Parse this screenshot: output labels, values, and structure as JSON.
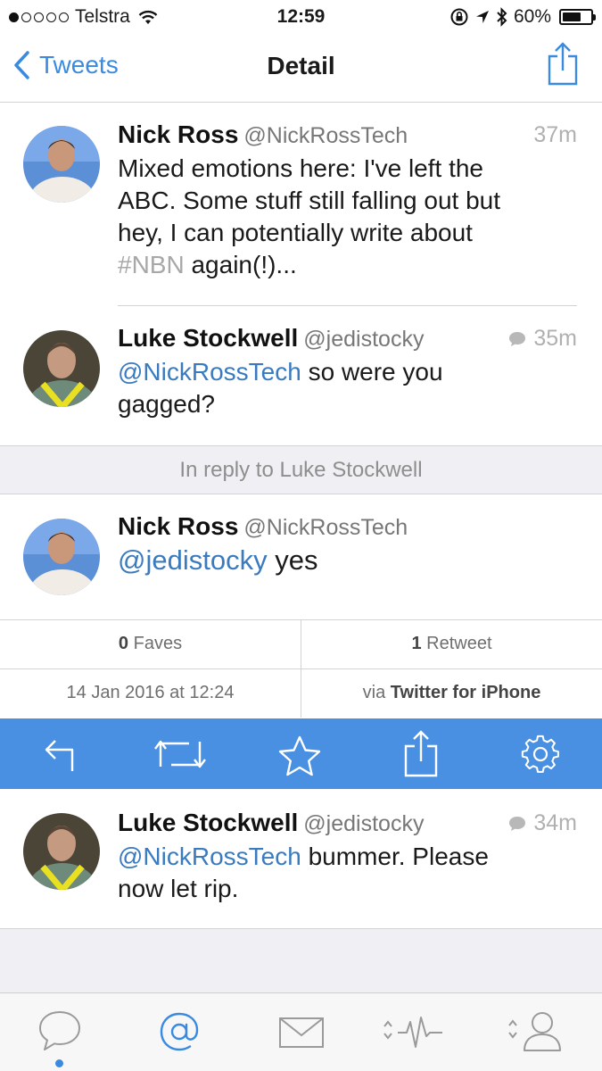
{
  "status_bar": {
    "carrier": "Telstra",
    "time": "12:59",
    "battery": "60%",
    "signal_bars": 1
  },
  "nav": {
    "back_label": "Tweets",
    "title": "Detail"
  },
  "tweets": [
    {
      "name": "Nick Ross",
      "handle": "@NickRossTech",
      "time": "37m",
      "body_lines": [
        "Mixed emotions here: I've left the",
        "ABC. Some stuff still falling out but",
        "hey, I can potentially write about"
      ],
      "hashtag": "#NBN",
      "body_tail": " again(!)..."
    },
    {
      "name": "Luke Stockwell",
      "handle": "@jedistocky",
      "time": "35m",
      "mention": "@NickRossTech",
      "body_rest": " so were you",
      "body_line2": "gagged?"
    },
    {
      "name": "Nick Ross",
      "handle": "@NickRossTech",
      "mention": "@jedistocky",
      "body_rest": " yes"
    },
    {
      "name": "Luke Stockwell",
      "handle": "@jedistocky",
      "time": "34m",
      "mention": "@NickRossTech",
      "body_rest": " bummer. Please",
      "body_line2": "now let rip."
    }
  ],
  "reply_bar": "In reply to Luke Stockwell",
  "stats": {
    "faves_count": "0",
    "faves_label": " Faves",
    "retweets_count": "1",
    "retweets_label": " Retweet",
    "date": "14 Jan 2016 at 12:24",
    "via_prefix": "via ",
    "via_app": "Twitter for iPhone"
  },
  "colors": {
    "accent": "#4a90e2",
    "link": "#3a7bbf",
    "background_gray": "#efeff4"
  },
  "icons": {
    "action_bar": [
      "reply-icon",
      "retweet-icon",
      "star-icon",
      "share-icon",
      "settings-gear-icon"
    ],
    "tab_bar": [
      "timeline-bubble-icon",
      "mentions-at-icon",
      "messages-envelope-icon",
      "activity-icon",
      "profile-icon"
    ]
  }
}
